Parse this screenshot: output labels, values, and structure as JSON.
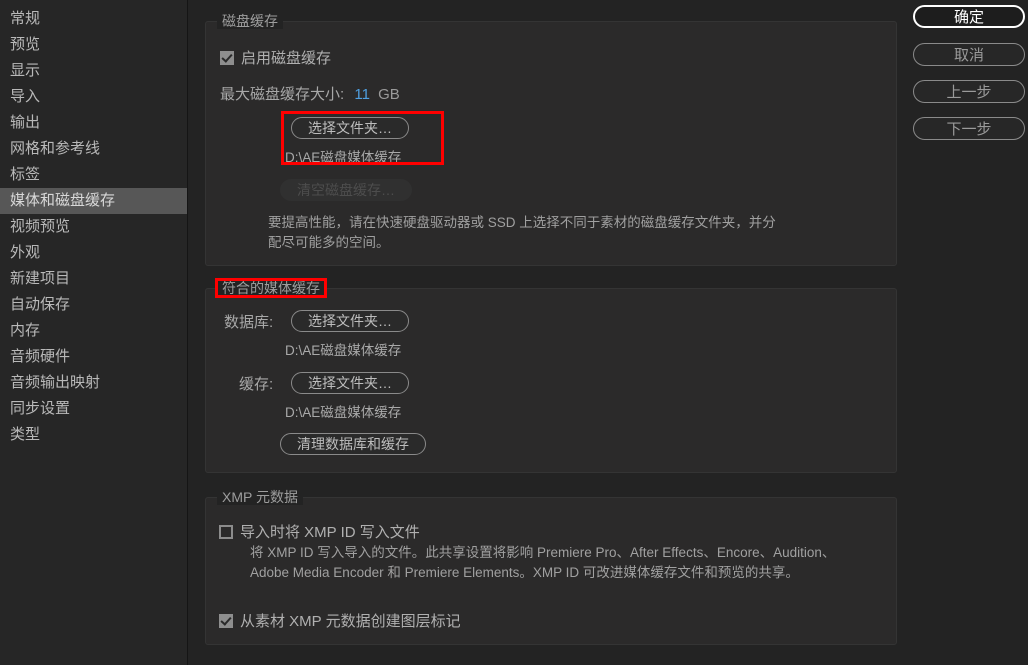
{
  "sidebar": {
    "items": [
      {
        "label": "常规",
        "selected": false
      },
      {
        "label": "预览",
        "selected": false
      },
      {
        "label": "显示",
        "selected": false
      },
      {
        "label": "导入",
        "selected": false
      },
      {
        "label": "输出",
        "selected": false
      },
      {
        "label": "网格和参考线",
        "selected": false
      },
      {
        "label": "标签",
        "selected": false
      },
      {
        "label": "媒体和磁盘缓存",
        "selected": true
      },
      {
        "label": "视频预览",
        "selected": false
      },
      {
        "label": "外观",
        "selected": false
      },
      {
        "label": "新建项目",
        "selected": false
      },
      {
        "label": "自动保存",
        "selected": false
      },
      {
        "label": "内存",
        "selected": false
      },
      {
        "label": "音频硬件",
        "selected": false
      },
      {
        "label": "音频输出映射",
        "selected": false
      },
      {
        "label": "同步设置",
        "selected": false
      },
      {
        "label": "类型",
        "selected": false
      }
    ]
  },
  "disk_cache": {
    "title": "磁盘缓存",
    "enable_label": "启用磁盘缓存",
    "enable_checked": true,
    "max_size_label": "最大磁盘缓存大小:",
    "max_size_value": "11",
    "max_size_unit": "GB",
    "choose_folder_button": "选择文件夹…",
    "folder_path": "D:\\AE磁盘媒体缓存",
    "empty_cache_button": "清空磁盘缓存…",
    "empty_cache_disabled": true,
    "description_line1": "要提高性能，请在快速硬盘驱动器或 SSD 上选择不同于素材的磁盘缓存文件夹，并分",
    "description_line2": "配尽可能多的空间。"
  },
  "media_cache": {
    "title": "符合的媒体缓存",
    "database_label": "数据库:",
    "database_button": "选择文件夹…",
    "database_path": "D:\\AE磁盘媒体缓存",
    "cache_label": "缓存:",
    "cache_button": "选择文件夹…",
    "cache_path": "D:\\AE磁盘媒体缓存",
    "clean_button": "清理数据库和缓存"
  },
  "xmp": {
    "title": "XMP 元数据",
    "write_id_label": "导入时将 XMP ID 写入文件",
    "write_id_checked": false,
    "description_line1": "将 XMP ID 写入导入的文件。此共享设置将影响 Premiere Pro、After Effects、Encore、Audition、",
    "description_line2": "Adobe Media Encoder 和 Premiere Elements。XMP ID 可改进媒体缓存文件和预览的共享。",
    "layer_markers_label": "从素材 XMP 元数据创建图层标记",
    "layer_markers_checked": true
  },
  "actions": {
    "ok": "确定",
    "cancel": "取消",
    "previous": "上一步",
    "next": "下一步"
  },
  "annotations": {
    "accent_color": "#ff0000"
  }
}
